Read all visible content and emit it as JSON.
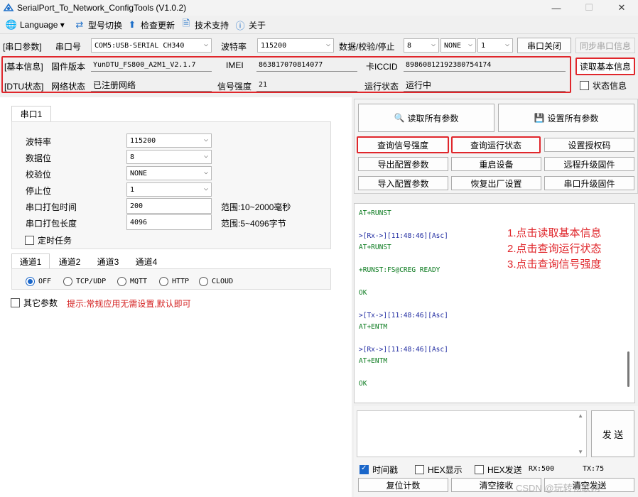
{
  "window": {
    "title": "SerialPort_To_Network_ConfigTools (V1.0.2)",
    "minimize": "—",
    "maximize": "☐",
    "close": "✕"
  },
  "menu": [
    {
      "label": "Language ▾",
      "icon": "globe-icon"
    },
    {
      "label": "型号切换",
      "icon": "switch-icon"
    },
    {
      "label": "检查更新",
      "icon": "upload-arrow-icon"
    },
    {
      "label": "技术支持",
      "icon": "document-icon"
    },
    {
      "label": "关于",
      "icon": "info-icon"
    }
  ],
  "serial_params": {
    "section": "[串口参数]",
    "port_label": "串口号",
    "port_value": "COM5:USB-SERIAL CH340",
    "baud_label": "波特率",
    "baud_value": "115200",
    "data_label": "数据/校验/停止",
    "data_bits": "8",
    "parity": "NONE",
    "stop_bits": "1",
    "close_port": "串口关闭",
    "sync_info": "同步串口信息"
  },
  "basic_info": {
    "section": "[基本信息]",
    "fw_label": "固件版本",
    "fw_value": "YunDTU_FS800_A2M1_V2.1.7",
    "imei_label": "IMEI",
    "imei_value": "863817070814077",
    "iccid_label": "卡ICCID",
    "iccid_value": "89860812192380754174",
    "read_btn": "读取基本信息"
  },
  "dtu_status": {
    "section": "[DTU状态]",
    "net_label": "网络状态",
    "net_value": "已注册网络",
    "signal_label": "信号强度",
    "signal_value": "21",
    "run_label": "运行状态",
    "run_value": "运行中",
    "status_check": "状态信息"
  },
  "left": {
    "tab": "串口1",
    "rows": [
      {
        "label": "波特率",
        "value": "115200",
        "type": "combo"
      },
      {
        "label": "数据位",
        "value": "8",
        "type": "combo"
      },
      {
        "label": "校验位",
        "value": "NONE",
        "type": "combo"
      },
      {
        "label": "停止位",
        "value": "1",
        "type": "combo"
      },
      {
        "label": "串口打包时间",
        "value": "200",
        "type": "input",
        "hint": "范围:10~2000毫秒"
      },
      {
        "label": "串口打包长度",
        "value": "4096",
        "type": "input",
        "hint": "范围:5~4096字节"
      }
    ],
    "timer_task": "定时任务",
    "channel_tabs": [
      "通道1",
      "通道2",
      "通道3",
      "通道4"
    ],
    "protocols": [
      "OFF",
      "TCP/UDP",
      "MQTT",
      "HTTP",
      "CLOUD"
    ],
    "other_params": "其它参数",
    "tip": "提示:常规应用无需设置,默认即可"
  },
  "right": {
    "read_all": "读取所有参数",
    "set_all": "设置所有参数",
    "buttons": [
      [
        "查询信号强度",
        "查询运行状态",
        "设置授权码"
      ],
      [
        "导出配置参数",
        "重启设备",
        "远程升级固件"
      ],
      [
        "导入配置参数",
        "恢复出厂设置",
        "串口升级固件"
      ]
    ],
    "log": [
      {
        "text": "AT+RUNST",
        "color": "green"
      },
      {
        "text": "",
        "color": "green"
      },
      {
        "text": ">[Rx->][11:48:46][Asc]",
        "color": "blue"
      },
      {
        "text": "AT+RUNST",
        "color": "green"
      },
      {
        "text": "",
        "color": "green"
      },
      {
        "text": "+RUNST:FS@CREG READY",
        "color": "green"
      },
      {
        "text": "",
        "color": "green"
      },
      {
        "text": "OK",
        "color": "green"
      },
      {
        "text": "",
        "color": "green"
      },
      {
        "text": ">[Tx->][11:48:46][Asc]",
        "color": "blue"
      },
      {
        "text": "AT+ENTM",
        "color": "green"
      },
      {
        "text": "",
        "color": "green"
      },
      {
        "text": ">[Rx->][11:48:46][Asc]",
        "color": "blue"
      },
      {
        "text": "AT+ENTM",
        "color": "green"
      },
      {
        "text": "",
        "color": "green"
      },
      {
        "text": "OK",
        "color": "green"
      }
    ],
    "annotations": [
      "1.点击读取基本信息",
      "2.点击查询运行状态",
      "3.点击查询信号强度"
    ],
    "send": "发 送",
    "timestamp": "时间戳",
    "hex_display": "HEX显示",
    "hex_send": "HEX发送",
    "rx": "RX:500",
    "tx": "TX:75",
    "reset_count": "复位计数",
    "clear_recv": "清空接收",
    "clear_send": "清空发送",
    "watermark": "CSDN @玩转物联网"
  },
  "colors": {
    "highlight": "#e0262b",
    "accent": "#1a66c9"
  }
}
